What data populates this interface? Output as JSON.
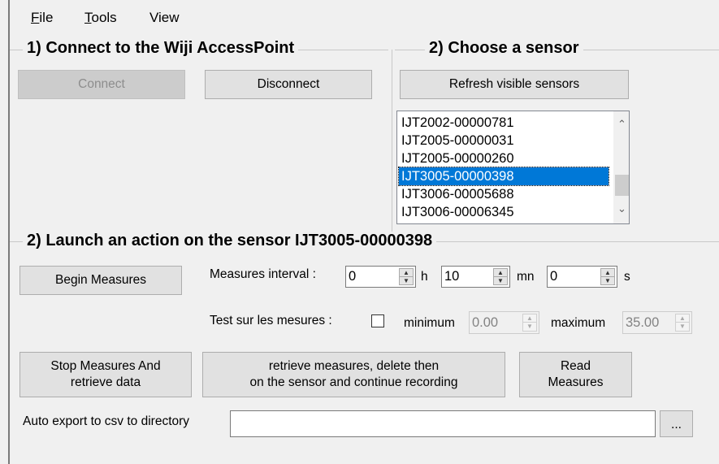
{
  "menu": {
    "file_first": "F",
    "file_rest": "ile",
    "tools_first": "T",
    "tools_rest": "ools",
    "view": "View"
  },
  "connect_group": {
    "title": "1) Connect to the Wiji AccessPoint",
    "connect_label": "Connect",
    "disconnect_label": "Disconnect"
  },
  "sensor_group": {
    "title": "2) Choose a sensor",
    "refresh_label": "Refresh visible sensors",
    "sensors": [
      "IJT2002-00000781",
      "IJT2005-00000031",
      "IJT2005-00000260",
      "IJT3005-00000398",
      "IJT3006-00005688",
      "IJT3006-00006345"
    ],
    "selected": "IJT3005-00000398"
  },
  "action_group": {
    "title": "2) Launch an action on the sensor IJT3005-00000398",
    "begin_label": "Begin Measures",
    "interval_label": "Measures interval :",
    "hours_value": "0",
    "hours_unit": "h",
    "minutes_value": "10",
    "minutes_unit": "mn",
    "seconds_value": "0",
    "seconds_unit": "s",
    "test_label": "Test sur les mesures :",
    "min_label": "minimum",
    "min_value": "0.00",
    "max_label": "maximum",
    "max_value": "35.00",
    "stop_line1": "Stop Measures And",
    "stop_line2": "retrieve data",
    "retrieve_line1": "retrieve measures, delete then",
    "retrieve_line2": "on the sensor and continue recording",
    "read_line1": "Read",
    "read_line2": "Measures",
    "export_label": "Auto export to csv to directory",
    "export_value": "",
    "browse_label": "..."
  }
}
